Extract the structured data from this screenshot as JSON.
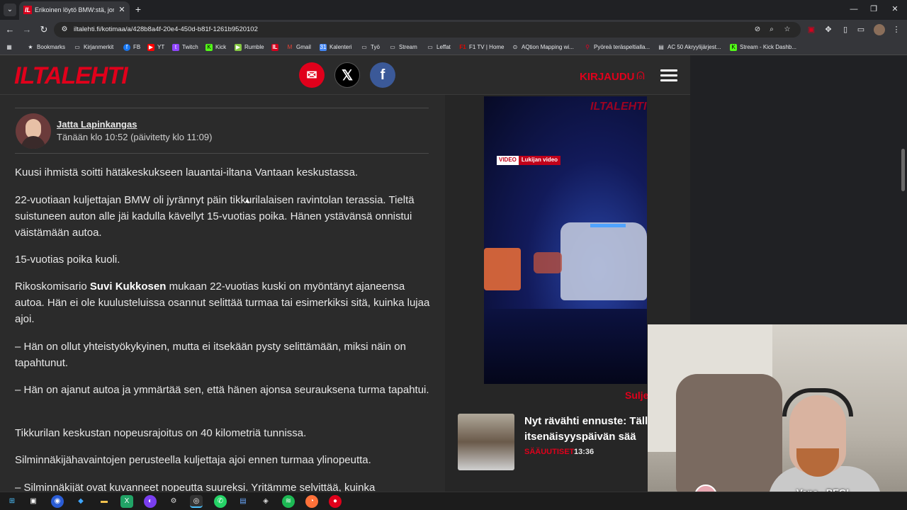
{
  "browser": {
    "tab_title": "Erikoinen löytö BMW:stä, jonka",
    "tab_favicon": "IL",
    "url": "iltalehti.fi/kotimaa/a/428b8a4f-20e4-450d-b81f-1261b9520102",
    "bookmarks": [
      {
        "label": "Bookmarks",
        "icon": "star-icon"
      },
      {
        "label": "Kirjanmerkit",
        "icon": "folder-icon"
      },
      {
        "label": "FB",
        "icon": "facebook-icon"
      },
      {
        "label": "YT",
        "icon": "youtube-icon"
      },
      {
        "label": "Twitch",
        "icon": "twitch-icon"
      },
      {
        "label": "Kick",
        "icon": "kick-icon"
      },
      {
        "label": "Rumble",
        "icon": "rumble-icon"
      },
      {
        "label": "",
        "icon": "iltalehti-icon"
      },
      {
        "label": "Gmail",
        "icon": "gmail-icon"
      },
      {
        "label": "Kalenteri",
        "icon": "calendar-icon"
      },
      {
        "label": "Työ",
        "icon": "folder-icon"
      },
      {
        "label": "Stream",
        "icon": "folder-icon"
      },
      {
        "label": "Leffat",
        "icon": "folder-icon"
      },
      {
        "label": "F1 TV | Home",
        "icon": "f1-icon"
      },
      {
        "label": "AQtion Mapping wi...",
        "icon": "aqtion-icon"
      },
      {
        "label": "Pyöreä teräspeltialla...",
        "icon": "pin-icon"
      },
      {
        "label": "AC 50 Akryylijärjest...",
        "icon": "page-icon"
      },
      {
        "label": "Stream - Kick Dashb...",
        "icon": "kick-icon"
      }
    ]
  },
  "site": {
    "logo": "ILTALEHTI",
    "login": "KIRJAUDU"
  },
  "article": {
    "author": "Jatta Lapinkangas",
    "timestamp": "Tänään klo 10:52 (päivitetty klo 11:09)",
    "p1": "Kuusi ihmistä soitti hätäkeskukseen lauantai-iltana Vantaan keskustassa.",
    "p2": "22-vuotiaan kuljettajan BMW oli jyrännyt päin tikkurilalaisen ravintolan terassia. Tieltä suistuneen auton alle jäi kadulla kävellyt 15-vuotias poika. Hänen ystävänsä onnistui väistämään autoa.",
    "p3": "15-vuotias poika kuoli.",
    "p4_pre": "Rikoskomisario ",
    "p4_bold": "Suvi Kukkosen",
    "p4_post": " mukaan 22-vuotias kuski on myöntänyt ajaneensa autoa. Hän ei ole kuulusteluissa osannut selittää turmaa tai esimerkiksi sitä, kuinka lujaa ajoi.",
    "p5": "– Hän on ollut yhteistyökykyinen, mutta ei itsekään pysty selittämään, miksi näin on tapahtunut.",
    "p6": "– Hän on ajanut autoa ja ymmärtää sen, että hänen ajonsa seurauksena turma tapahtui.",
    "p7": "Tikkurilan keskustan nopeusrajoitus on 40 kilometriä tunnissa.",
    "p8": "Silminnäkijähavaintojen perusteella kuljettaja ajoi ennen turmaa ylinopeutta.",
    "p9": "– Silminnäkijät ovat kuvanneet nopeutta suureksi. Yritämme selvittää, kuinka"
  },
  "sidebar": {
    "video_logo": "ILTALEHTI",
    "video_badge": "VIDEO",
    "video_label": "Lukijan video",
    "close": "Sulje",
    "news_title": "Nyt rävähti ennuste: Tällä on itsenäisyyspäivän sää",
    "news_category": "SÄÄUUTISET",
    "news_time": "13:36"
  },
  "webcam": {
    "label": "Vana - BEG!"
  },
  "colors": {
    "brand": "#e0001b",
    "page_bg": "#2b2b2b"
  }
}
